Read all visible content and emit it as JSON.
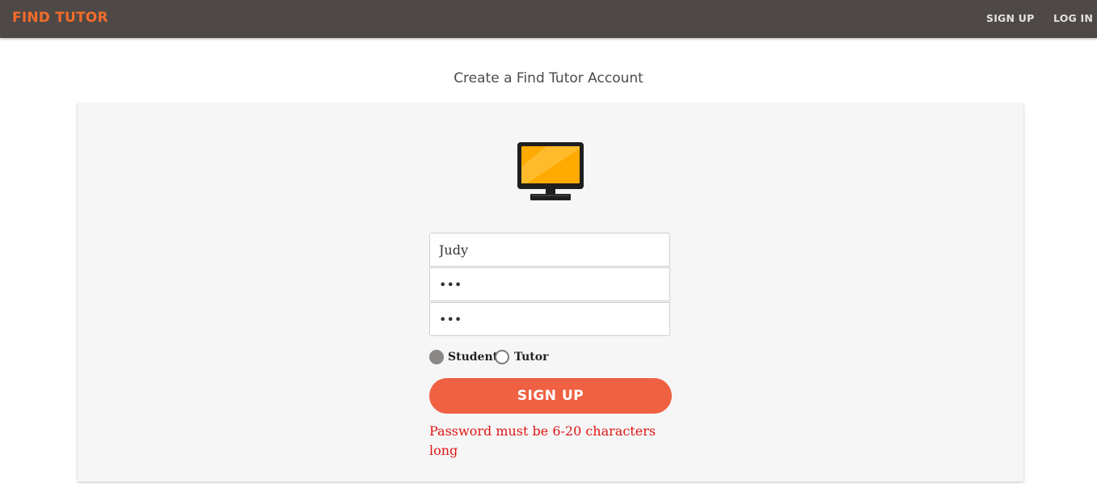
{
  "navbar": {
    "brand": "FIND TUTOR",
    "links": [
      {
        "label": "SIGN UP"
      },
      {
        "label": "LOG IN"
      }
    ]
  },
  "page": {
    "title": "Create a Find Tutor Account"
  },
  "form": {
    "icon": "monitor-icon",
    "username": {
      "value": "Judy",
      "placeholder": ""
    },
    "password": {
      "value": "•••",
      "placeholder": ""
    },
    "confirm_password": {
      "value": "•••",
      "placeholder": ""
    },
    "roles": {
      "options": [
        {
          "label": "Student",
          "selected": true
        },
        {
          "label": "Tutor",
          "selected": false
        }
      ]
    },
    "submit_label": "SIGN UP",
    "error": "Password must be 6-20 characters long"
  },
  "colors": {
    "navbar_bg": "#4e4946",
    "brand": "#f36b2a",
    "button": "#f06042",
    "error": "#e01515",
    "monitor_screen": "#ffaa00"
  }
}
